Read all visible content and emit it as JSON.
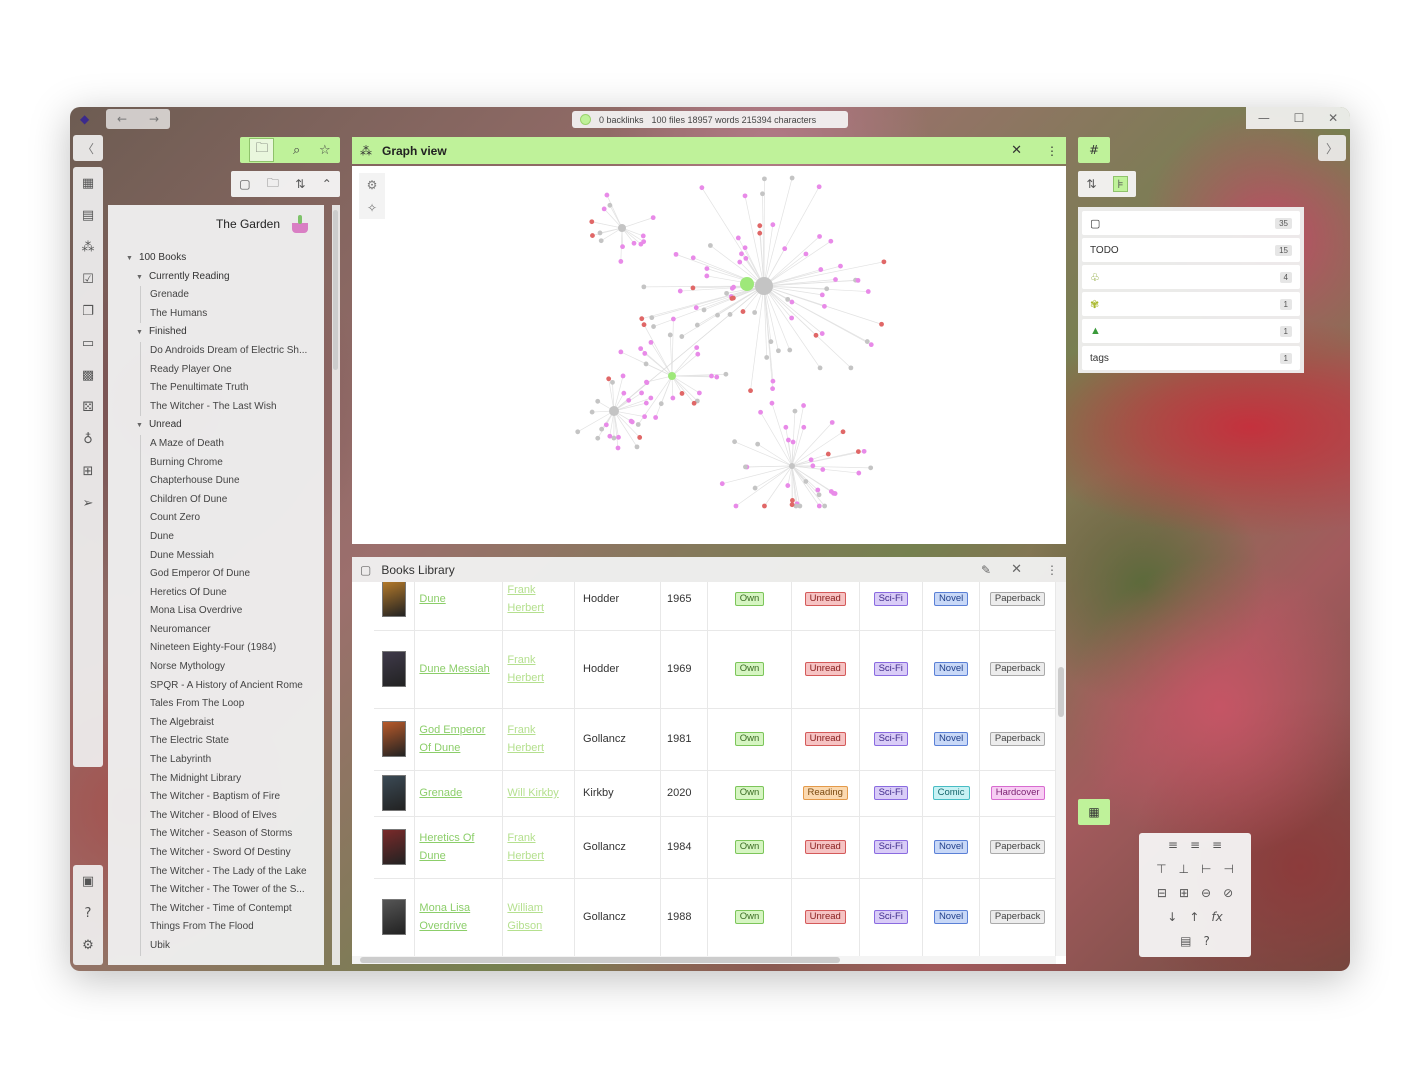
{
  "titlebar": {
    "back": "←",
    "forward": "→",
    "backlinks": "0 backlinks",
    "stats": "100 files 18957 words 215394 characters",
    "minimize": "—",
    "maximize": "☐",
    "close": "✕"
  },
  "explorer": {
    "vault_name": "The Garden",
    "root_folder": "100 Books",
    "folders": [
      {
        "name": "Currently Reading",
        "items": [
          "Grenade",
          "The Humans"
        ]
      },
      {
        "name": "Finished",
        "items": [
          "Do Androids Dream of Electric Sh...",
          "Ready Player One",
          "The Penultimate Truth",
          "The Witcher - The Last Wish"
        ]
      },
      {
        "name": "Unread",
        "items": [
          "A Maze of Death",
          "Burning Chrome",
          "Chapterhouse Dune",
          "Children Of Dune",
          "Count Zero",
          "Dune",
          "Dune Messiah",
          "God Emperor Of Dune",
          "Heretics Of Dune",
          "Mona Lisa Overdrive",
          "Neuromancer",
          "Nineteen Eighty-Four (1984)",
          "Norse Mythology",
          "SPQR - A History of Ancient Rome",
          "Tales From The Loop",
          "The Algebraist",
          "The Electric State",
          "The Labyrinth",
          "The Midnight Library",
          "The Witcher - Baptism of Fire",
          "The Witcher - Blood of Elves",
          "The Witcher - Season of Storms",
          "The Witcher - Sword Of Destiny",
          "The Witcher - The Lady of the Lake",
          "The Witcher - The Tower of the S...",
          "The Witcher - Time of Contempt",
          "Things From The Flood",
          "Ubik"
        ]
      }
    ]
  },
  "graph": {
    "title": "Graph view"
  },
  "library": {
    "title": "Books Library",
    "rows": [
      {
        "title_lines": [
          "Dune"
        ],
        "author_lines": [
          "Frank",
          "Herbert"
        ],
        "publisher": "Hodder",
        "year": "1965",
        "own": "Own",
        "status": "Unread",
        "genre": "Sci-Fi",
        "form": "Novel",
        "format": "Paperback"
      },
      {
        "title_lines": [
          "Dune Messiah"
        ],
        "author_lines": [
          "Frank",
          "Herbert"
        ],
        "publisher": "Hodder",
        "year": "1969",
        "own": "Own",
        "status": "Unread",
        "genre": "Sci-Fi",
        "form": "Novel",
        "format": "Paperback"
      },
      {
        "title_lines": [
          "God Emperor",
          "Of Dune"
        ],
        "author_lines": [
          "Frank",
          "Herbert"
        ],
        "publisher": "Gollancz",
        "year": "1981",
        "own": "Own",
        "status": "Unread",
        "genre": "Sci-Fi",
        "form": "Novel",
        "format": "Paperback"
      },
      {
        "title_lines": [
          "Grenade"
        ],
        "author_lines": [
          "Will Kirkby"
        ],
        "publisher": "Kirkby",
        "year": "2020",
        "own": "Own",
        "status": "Reading",
        "genre": "Sci-Fi",
        "form": "Comic",
        "format": "Hardcover"
      },
      {
        "title_lines": [
          "Heretics Of",
          "Dune"
        ],
        "author_lines": [
          "Frank",
          "Herbert"
        ],
        "publisher": "Gollancz",
        "year": "1984",
        "own": "Own",
        "status": "Unread",
        "genre": "Sci-Fi",
        "form": "Novel",
        "format": "Paperback"
      },
      {
        "title_lines": [
          "Mona Lisa",
          "Overdrive"
        ],
        "author_lines": [
          "William",
          "Gibson"
        ],
        "publisher": "Gollancz",
        "year": "1988",
        "own": "Own",
        "status": "Unread",
        "genre": "Sci-Fi",
        "form": "Novel",
        "format": "Paperback"
      }
    ]
  },
  "tags": {
    "header_icon": "#",
    "items": [
      {
        "label": "",
        "icon": "file-icon",
        "count": "35"
      },
      {
        "label": "TODO",
        "icon": "",
        "count": "15"
      },
      {
        "label": "",
        "icon": "seedling-icon",
        "count": "4"
      },
      {
        "label": "",
        "icon": "sparkle-plant-icon",
        "count": "1"
      },
      {
        "label": "",
        "icon": "tree-icon",
        "count": "1"
      },
      {
        "label": "tags",
        "icon": "",
        "count": "1"
      }
    ]
  },
  "colors": {
    "accent": "#bff29a",
    "pink_node": "#e88ae8",
    "red_node": "#e06767",
    "grey_node": "#c4c4c4",
    "green_node": "#9ee87a"
  }
}
